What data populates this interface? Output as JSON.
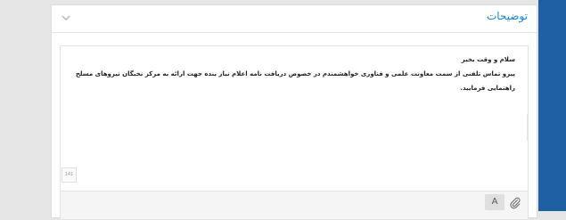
{
  "panel": {
    "title": "توضیحات"
  },
  "editor": {
    "greeting": "سلام و وقت بخیر",
    "body": "پیرو تماس تلفنی از سمت معاونت علمی و فناوری خواهشمندم در خصوص دریافت نامه اعلام نیاز بنده جهت ارائه به مرکز نخبگان نیروهای مسلح راهنمایی فرمایید.",
    "char_count": "141"
  },
  "toolbar": {
    "format_label": "A"
  },
  "colors": {
    "accent": "#1a85c8",
    "side_strip": "#1f5fa4"
  }
}
